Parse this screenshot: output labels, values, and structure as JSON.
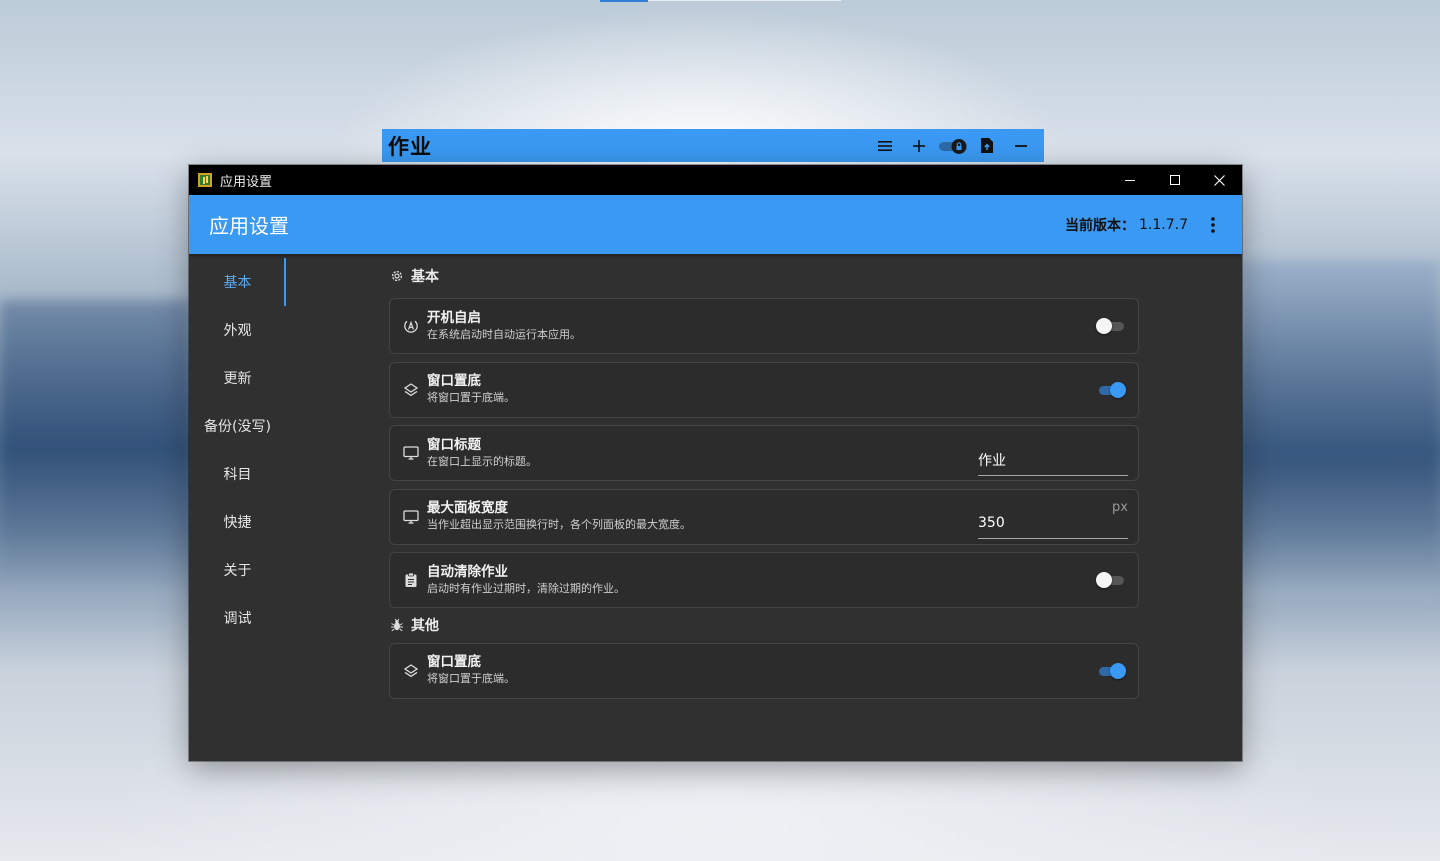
{
  "widget": {
    "title": "作业",
    "buttons": [
      "menu-icon",
      "plus-icon",
      "lock-toggle-icon",
      "file-export-icon",
      "minus-icon"
    ]
  },
  "window": {
    "titlebar_title": "应用设置",
    "header_title": "应用设置",
    "version_label": "当前版本：",
    "version_value": "1.1.7.7",
    "accent_color": "#3a99f2"
  },
  "sidebar": {
    "items": [
      {
        "label": "基本",
        "active": true
      },
      {
        "label": "外观",
        "active": false
      },
      {
        "label": "更新",
        "active": false
      },
      {
        "label": "备份(没写)",
        "active": false
      },
      {
        "label": "科目",
        "active": false
      },
      {
        "label": "快捷",
        "active": false
      },
      {
        "label": "关于",
        "active": false
      },
      {
        "label": "调试",
        "active": false
      }
    ]
  },
  "sections": {
    "basic": {
      "title": "基本",
      "autostart": {
        "title": "开机自启",
        "subtitle": "在系统启动时自动运行本应用。",
        "enabled": false
      },
      "bottom": {
        "title": "窗口置底",
        "subtitle": "将窗口置于底端。",
        "enabled": true
      },
      "window_title": {
        "title": "窗口标题",
        "subtitle": "在窗口上显示的标题。",
        "value": "作业"
      },
      "max_width": {
        "title": "最大面板宽度",
        "subtitle": "当作业超出显示范围换行时，各个列面板的最大宽度。",
        "value": "350",
        "unit": "px"
      },
      "auto_clear": {
        "title": "自动清除作业",
        "subtitle": "启动时有作业过期时，清除过期的作业。",
        "enabled": false
      }
    },
    "other": {
      "title": "其他",
      "bottom": {
        "title": "窗口置底",
        "subtitle": "将窗口置于底端。",
        "enabled": true
      }
    }
  }
}
